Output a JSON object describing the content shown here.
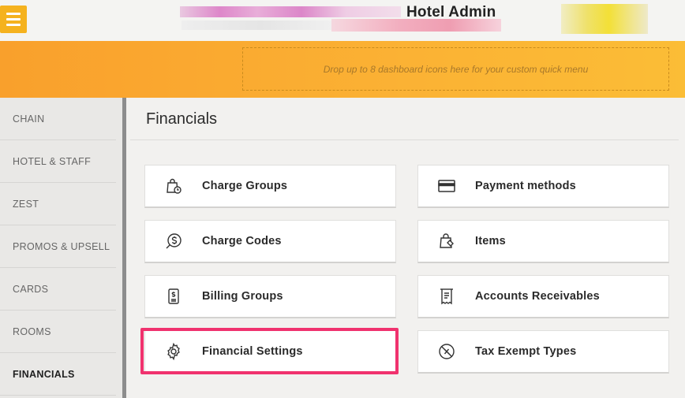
{
  "header": {
    "title": "Hotel Admin",
    "menu_icon": "hamburger-icon"
  },
  "quick_menu": {
    "placeholder": "Drop up to 8 dashboard icons here for your custom quick menu"
  },
  "sidebar": {
    "items": [
      {
        "label": "CHAIN"
      },
      {
        "label": "HOTEL & STAFF"
      },
      {
        "label": "ZEST"
      },
      {
        "label": "PROMOS & UPSELL"
      },
      {
        "label": "CARDS"
      },
      {
        "label": "ROOMS"
      },
      {
        "label": "FINANCIALS",
        "active": true
      }
    ]
  },
  "main": {
    "title": "Financials",
    "cards": [
      {
        "label": "Charge Groups",
        "icon": "bag-clock-icon"
      },
      {
        "label": "Payment methods",
        "icon": "credit-card-icon"
      },
      {
        "label": "Charge Codes",
        "icon": "dollar-coin-icon"
      },
      {
        "label": "Items",
        "icon": "shopping-bag-tag-icon"
      },
      {
        "label": "Billing Groups",
        "icon": "receipt-dollar-icon"
      },
      {
        "label": "Accounts Receivables",
        "icon": "receipt-icon"
      },
      {
        "label": "Financial Settings",
        "icon": "gear-icon",
        "highlighted": true
      },
      {
        "label": "Tax Exempt Types",
        "icon": "no-tax-icon"
      }
    ]
  },
  "colors": {
    "accent": "#f9a02c",
    "menu_button": "#f5b21e",
    "highlight": "#f0326e"
  }
}
